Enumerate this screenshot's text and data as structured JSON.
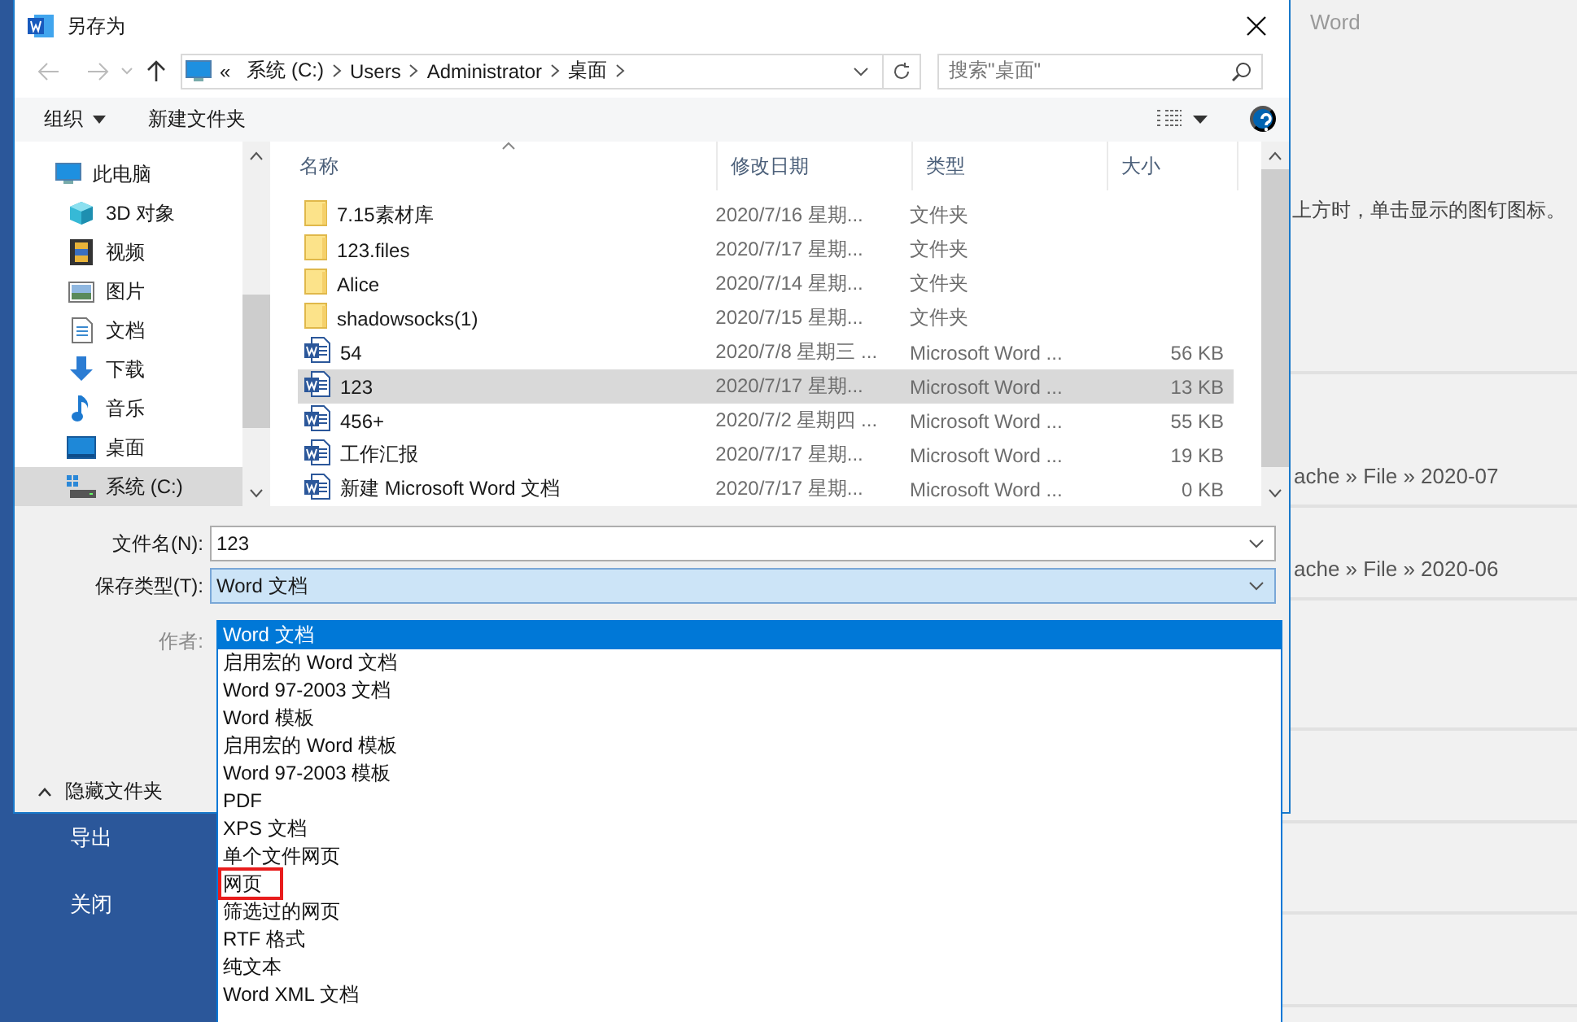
{
  "backstage": {
    "app_name": "Word",
    "sidebar": [
      {
        "label": "导出"
      },
      {
        "label": "关闭"
      }
    ],
    "pin_hint": "上方时，单击显示的图钉图标。",
    "recent_paths": [
      "ache » File » 2020-07",
      "ache » File » 2020-06"
    ]
  },
  "window": {
    "title": "另存为"
  },
  "address": {
    "overflow_marker": "«",
    "path": [
      "系统 (C:)",
      "Users",
      "Administrator",
      "桌面"
    ]
  },
  "search": {
    "placeholder": "搜索\"桌面\""
  },
  "toolbar": {
    "organize": "组织",
    "new_folder": "新建文件夹"
  },
  "nav_pane": {
    "items": [
      {
        "label": "此电脑",
        "kind": "pc",
        "selected": false,
        "children": [
          {
            "label": "3D 对象",
            "kind": "cube",
            "selected": false
          },
          {
            "label": "视频",
            "kind": "video",
            "selected": false
          },
          {
            "label": "图片",
            "kind": "picture",
            "selected": false
          },
          {
            "label": "文档",
            "kind": "document",
            "selected": false
          },
          {
            "label": "下载",
            "kind": "download",
            "selected": false
          },
          {
            "label": "音乐",
            "kind": "music",
            "selected": false
          },
          {
            "label": "桌面",
            "kind": "desktop",
            "selected": false
          },
          {
            "label": "系统 (C:)",
            "kind": "drive",
            "selected": true
          }
        ]
      }
    ]
  },
  "file_list": {
    "columns": [
      {
        "label": "名称",
        "sorted": true
      },
      {
        "label": "修改日期",
        "sorted": false
      },
      {
        "label": "类型",
        "sorted": false
      },
      {
        "label": "大小",
        "sorted": false
      }
    ],
    "rows": [
      {
        "name": "7.15素材库",
        "kind": "folder",
        "modified": "2020/7/16 星期...",
        "type": "文件夹",
        "size": "",
        "selected": false
      },
      {
        "name": "123.files",
        "kind": "folder",
        "modified": "2020/7/17 星期...",
        "type": "文件夹",
        "size": "",
        "selected": false
      },
      {
        "name": "Alice",
        "kind": "folder",
        "modified": "2020/7/14 星期...",
        "type": "文件夹",
        "size": "",
        "selected": false
      },
      {
        "name": "shadowsocks(1)",
        "kind": "folder",
        "modified": "2020/7/15 星期...",
        "type": "文件夹",
        "size": "",
        "selected": false
      },
      {
        "name": "54",
        "kind": "word",
        "modified": "2020/7/8 星期三 ...",
        "type": "Microsoft Word ...",
        "size": "56 KB",
        "selected": false
      },
      {
        "name": "123",
        "kind": "word",
        "modified": "2020/7/17 星期...",
        "type": "Microsoft Word ...",
        "size": "13 KB",
        "selected": true
      },
      {
        "name": "456+",
        "kind": "word",
        "modified": "2020/7/2 星期四 ...",
        "type": "Microsoft Word ...",
        "size": "55 KB",
        "selected": false
      },
      {
        "name": "工作汇报",
        "kind": "word",
        "modified": "2020/7/17 星期...",
        "type": "Microsoft Word ...",
        "size": "19 KB",
        "selected": false
      },
      {
        "name": "新建 Microsoft Word 文档",
        "kind": "word",
        "modified": "2020/7/17 星期...",
        "type": "Microsoft Word ...",
        "size": "0 KB",
        "selected": false
      }
    ]
  },
  "file_name": {
    "label": "文件名(N):",
    "value": "123"
  },
  "save_type": {
    "label": "保存类型(T):",
    "value": "Word 文档",
    "expanded": true,
    "options": [
      {
        "label": "Word 文档",
        "selected": true,
        "highlighted": false
      },
      {
        "label": "启用宏的 Word 文档",
        "selected": false,
        "highlighted": false
      },
      {
        "label": "Word 97-2003 文档",
        "selected": false,
        "highlighted": false
      },
      {
        "label": "Word 模板",
        "selected": false,
        "highlighted": false
      },
      {
        "label": "启用宏的 Word 模板",
        "selected": false,
        "highlighted": false
      },
      {
        "label": "Word 97-2003 模板",
        "selected": false,
        "highlighted": false
      },
      {
        "label": "PDF",
        "selected": false,
        "highlighted": false
      },
      {
        "label": "XPS 文档",
        "selected": false,
        "highlighted": false
      },
      {
        "label": "单个文件网页",
        "selected": false,
        "highlighted": false
      },
      {
        "label": "网页",
        "selected": false,
        "highlighted": true
      },
      {
        "label": "筛选过的网页",
        "selected": false,
        "highlighted": false
      },
      {
        "label": "RTF 格式",
        "selected": false,
        "highlighted": false
      },
      {
        "label": "纯文本",
        "selected": false,
        "highlighted": false
      },
      {
        "label": "Word XML 文档",
        "selected": false,
        "highlighted": false
      }
    ]
  },
  "authors": {
    "label": "作者:"
  },
  "hide_folders": {
    "label": "隐藏文件夹"
  }
}
